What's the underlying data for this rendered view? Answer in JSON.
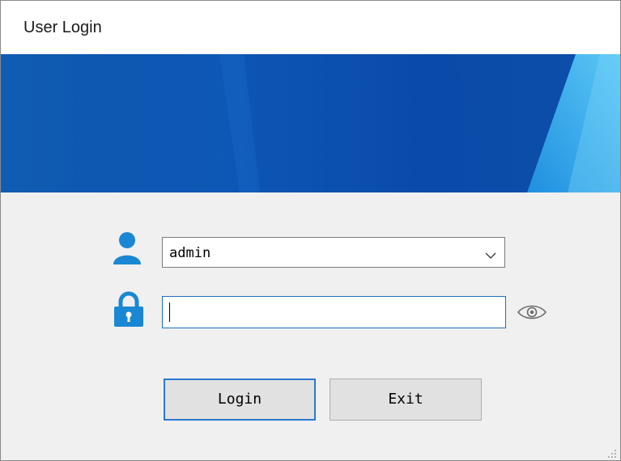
{
  "window": {
    "title": "User Login"
  },
  "login_form": {
    "username": {
      "icon": "user-icon",
      "value": "admin"
    },
    "password": {
      "icon": "lock-icon",
      "value": "",
      "show_icon": "eye-icon"
    },
    "login_label": "Login",
    "exit_label": "Exit"
  },
  "colors": {
    "accent": "#1a87d4",
    "focus_border": "#1f6fc0",
    "banner_dark": "#0a3d8f",
    "banner_light": "#2fa8e8"
  }
}
